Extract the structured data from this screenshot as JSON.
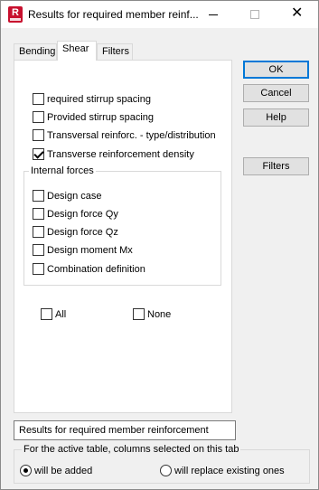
{
  "window": {
    "title": "Results for required member reinf...",
    "app_icon_letter": "R"
  },
  "tabs": [
    {
      "label": "Bending",
      "active": false
    },
    {
      "label": "Shear",
      "active": true
    },
    {
      "label": "Filters",
      "active": false
    }
  ],
  "options": [
    {
      "label": "required stirrup spacing",
      "checked": false
    },
    {
      "label": "Provided stirrup spacing",
      "checked": false
    },
    {
      "label": "Transversal reinforc. - type/distribution",
      "checked": false
    },
    {
      "label": "Transverse reinforcement density",
      "checked": true
    }
  ],
  "internal_forces": {
    "title": "Internal forces",
    "items": [
      {
        "label": "Design case",
        "checked": false
      },
      {
        "label": "Design force Qy",
        "checked": false
      },
      {
        "label": "Design force Qz",
        "checked": false
      },
      {
        "label": "Design moment Mx",
        "checked": false
      },
      {
        "label": "Combination definition",
        "checked": false
      }
    ]
  },
  "select_all": {
    "all_label": "All",
    "none_label": "None"
  },
  "buttons": {
    "ok": "OK",
    "cancel": "Cancel",
    "help": "Help",
    "filters": "Filters"
  },
  "table_name": "Results for required member reinforcement",
  "columns_mode": {
    "title": "For the active table, columns selected on this tab",
    "added_label": "will be added",
    "replace_label": "will replace existing ones",
    "selected": "added"
  },
  "colors": {
    "accent": "#0078d7",
    "app_icon": "#c8102e"
  }
}
